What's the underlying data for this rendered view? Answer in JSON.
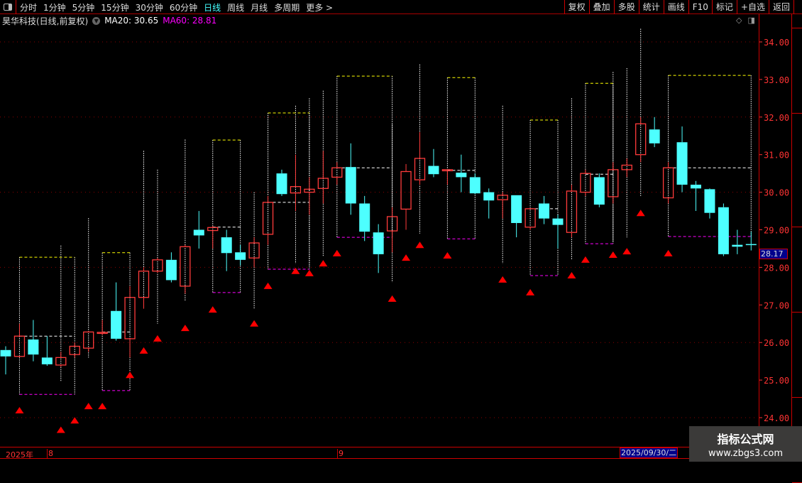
{
  "toolbar": {
    "periods": [
      "分时",
      "1分钟",
      "5分钟",
      "15分钟",
      "30分钟",
      "60分钟",
      "日线",
      "周线",
      "月线",
      "多周期",
      "更多 >"
    ],
    "active_period": "日线",
    "buttons": [
      "复权",
      "叠加",
      "多股",
      "统计",
      "画线",
      "F10",
      "标记",
      "+自选",
      "返回"
    ]
  },
  "header": {
    "title": "昊华科技(日线,前复权)",
    "ma20": "MA20: 30.65",
    "ma60": "MA60: 28.81"
  },
  "colors": {
    "up": "#ff3b3b",
    "down": "#4dffff",
    "ma60": "#ff00ff",
    "ma20": "#ffffff",
    "axis": "#ff3333",
    "grid": "#8b0000",
    "signal": "#ff0000",
    "box_top": "#ffff00",
    "box_bottom": "#ff00ff"
  },
  "price_axis": {
    "ticks": [
      "34.00",
      "33.00",
      "32.00",
      "31.00",
      "30.00",
      "29.00",
      "28.00",
      "27.00",
      "26.00",
      "25.00",
      "24.00"
    ],
    "current_price": "28.17"
  },
  "date_axis": {
    "year": "2025年",
    "months": [
      "8",
      "9"
    ],
    "cursor_date": "2025/09/30/二"
  },
  "watermark": {
    "title": "指标公式网",
    "url": "www.zbgs3.com"
  },
  "chart_data": {
    "type": "candlestick",
    "ylim": [
      23.5,
      34.5
    ],
    "candles": [
      [
        25.8,
        25.9,
        25.15,
        25.63
      ],
      [
        25.63,
        26.5,
        25.6,
        26.17
      ],
      [
        26.08,
        26.6,
        25.5,
        25.68
      ],
      [
        25.6,
        26.17,
        25.38,
        25.42
      ],
      [
        25.4,
        25.75,
        25.35,
        25.6
      ],
      [
        25.68,
        26.0,
        25.6,
        25.9
      ],
      [
        25.85,
        26.3,
        25.75,
        26.28
      ],
      [
        26.25,
        26.6,
        26.2,
        26.27
      ],
      [
        26.84,
        27.6,
        26.05,
        26.1
      ],
      [
        26.1,
        27.5,
        25.6,
        27.2
      ],
      [
        27.2,
        28.0,
        26.9,
        27.9
      ],
      [
        27.9,
        28.25,
        27.85,
        28.2
      ],
      [
        28.2,
        28.4,
        27.6,
        27.66
      ],
      [
        27.5,
        28.6,
        27.3,
        28.55
      ],
      [
        29.0,
        29.5,
        28.5,
        28.85
      ],
      [
        28.98,
        29.1,
        28.5,
        29.06
      ],
      [
        28.8,
        29.0,
        27.9,
        28.38
      ],
      [
        28.4,
        28.6,
        28.05,
        28.2
      ],
      [
        28.25,
        28.8,
        28.0,
        28.65
      ],
      [
        28.88,
        29.9,
        28.6,
        29.73
      ],
      [
        30.5,
        30.6,
        29.9,
        29.95
      ],
      [
        29.98,
        31.0,
        29.5,
        30.15
      ],
      [
        30.0,
        30.4,
        29.4,
        30.08
      ],
      [
        30.1,
        31.1,
        29.7,
        30.37
      ],
      [
        30.4,
        30.8,
        30.2,
        30.65
      ],
      [
        30.67,
        31.3,
        29.4,
        29.7
      ],
      [
        29.7,
        29.9,
        28.7,
        28.95
      ],
      [
        28.93,
        29.15,
        27.85,
        28.35
      ],
      [
        28.97,
        29.6,
        28.4,
        29.35
      ],
      [
        29.55,
        30.75,
        29.0,
        30.55
      ],
      [
        30.33,
        31.6,
        30.2,
        30.9
      ],
      [
        30.7,
        31.15,
        30.4,
        30.48
      ],
      [
        30.57,
        30.6,
        30.2,
        30.6
      ],
      [
        30.52,
        31.0,
        30.0,
        30.4
      ],
      [
        30.4,
        30.5,
        29.95,
        29.97
      ],
      [
        30.0,
        30.1,
        29.3,
        29.78
      ],
      [
        29.8,
        30.0,
        29.3,
        29.92
      ],
      [
        29.92,
        29.92,
        28.8,
        29.18
      ],
      [
        29.07,
        29.56,
        29.0,
        29.56
      ],
      [
        29.7,
        29.9,
        29.15,
        29.3
      ],
      [
        29.3,
        29.4,
        28.5,
        29.13
      ],
      [
        28.93,
        30.2,
        28.8,
        30.03
      ],
      [
        30.0,
        30.6,
        29.9,
        30.5
      ],
      [
        30.4,
        30.5,
        29.6,
        29.67
      ],
      [
        29.88,
        30.8,
        29.7,
        30.6
      ],
      [
        30.6,
        30.9,
        30.4,
        30.72
      ],
      [
        31.0,
        32.0,
        30.8,
        31.82
      ],
      [
        31.67,
        32.0,
        31.2,
        31.3
      ],
      [
        29.85,
        30.8,
        29.7,
        30.65
      ],
      [
        31.33,
        31.75,
        30.0,
        30.2
      ],
      [
        30.2,
        30.3,
        29.5,
        30.1
      ],
      [
        30.08,
        30.1,
        29.3,
        29.45
      ],
      [
        29.6,
        29.7,
        28.3,
        28.35
      ],
      [
        28.6,
        29.0,
        28.35,
        28.55
      ],
      [
        28.62,
        28.95,
        28.45,
        28.6
      ]
    ],
    "candle_fields": [
      "open",
      "high",
      "low",
      "close"
    ],
    "signals": [
      [
        2,
        24.19
      ],
      [
        5,
        23.67
      ],
      [
        6,
        23.92
      ],
      [
        7,
        24.3
      ],
      [
        8,
        24.3
      ],
      [
        10,
        25.13
      ],
      [
        11,
        25.78
      ],
      [
        12,
        26.1
      ],
      [
        14,
        26.38
      ],
      [
        16,
        26.87
      ],
      [
        19,
        26.5
      ],
      [
        20,
        27.5
      ],
      [
        22,
        27.9
      ],
      [
        23,
        27.84
      ],
      [
        24,
        28.1
      ],
      [
        25,
        28.37
      ],
      [
        29,
        27.16
      ],
      [
        30,
        28.25
      ],
      [
        31,
        28.59
      ],
      [
        33,
        28.31
      ],
      [
        37,
        27.67
      ],
      [
        39,
        27.33
      ],
      [
        42,
        27.78
      ],
      [
        43,
        28.2
      ],
      [
        45,
        28.33
      ],
      [
        46,
        28.42
      ],
      [
        47,
        29.44
      ],
      [
        49,
        28.37
      ]
    ],
    "boxes": [
      [
        2,
        6,
        28.27,
        26.17,
        24.62
      ],
      [
        8,
        10,
        28.39,
        26.28,
        24.72
      ],
      [
        16,
        18,
        31.39,
        29.07,
        27.33
      ],
      [
        20,
        23,
        32.11,
        29.73,
        27.95
      ],
      [
        25,
        29,
        33.09,
        30.65,
        28.8
      ],
      [
        33,
        35,
        33.05,
        30.58,
        28.76
      ],
      [
        39,
        41,
        31.92,
        29.56,
        27.78
      ],
      [
        43,
        45,
        32.9,
        30.48,
        28.63
      ],
      [
        49,
        55,
        33.11,
        30.65,
        28.82
      ]
    ],
    "box_fields": [
      "start_index",
      "end_index",
      "top",
      "mid",
      "bottom"
    ],
    "vlines": [
      [
        5,
        28.58,
        24.96
      ],
      [
        7,
        29.31,
        25.6
      ],
      [
        11,
        31.1,
        27.17
      ],
      [
        12,
        30.6,
        26.5
      ],
      [
        14,
        31.4,
        27.1
      ],
      [
        19,
        30.0,
        26.9
      ],
      [
        22,
        32.3,
        28.1
      ],
      [
        23,
        32.5,
        28.0
      ],
      [
        24,
        32.7,
        28.3
      ],
      [
        29,
        31.8,
        27.6
      ],
      [
        31,
        33.4,
        28.9
      ],
      [
        37,
        32.3,
        28.1
      ],
      [
        42,
        32.5,
        28.2
      ],
      [
        45,
        33.2,
        28.7
      ],
      [
        46,
        33.3,
        28.8
      ],
      [
        47,
        34.35,
        29.9
      ]
    ]
  }
}
